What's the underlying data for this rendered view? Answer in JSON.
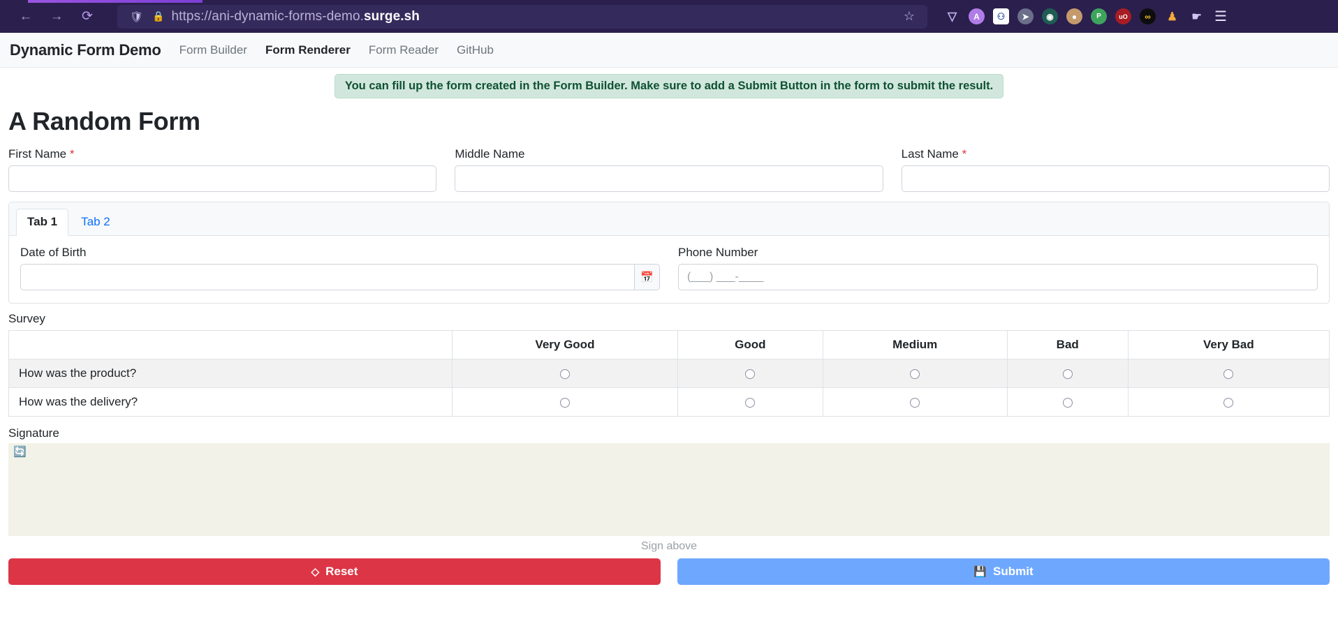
{
  "browser": {
    "url_prefix": "https://ani-dynamic-forms-demo.",
    "url_domain": "surge.sh",
    "back_icon": "back-arrow-icon",
    "forward_icon": "forward-arrow-icon",
    "reload_icon": "reload-icon",
    "shield_icon": "shield-icon",
    "lock_icon": "padlock-icon",
    "bookmark_icon": "star-icon",
    "menu_icon": "hamburger-menu-icon",
    "extensions": [
      {
        "name": "pocket-icon",
        "glyph": "▽"
      },
      {
        "name": "avatar-a-icon",
        "glyph": "A"
      },
      {
        "name": "bitwarden-icon",
        "glyph": "⬛"
      },
      {
        "name": "cursor-icon",
        "glyph": "➤"
      },
      {
        "name": "goggles-icon",
        "glyph": "◉"
      },
      {
        "name": "cookie-icon",
        "glyph": "●"
      },
      {
        "name": "pdf-icon",
        "glyph": "Pdf"
      },
      {
        "name": "ublock-icon",
        "glyph": "uO"
      },
      {
        "name": "infinity-icon",
        "glyph": "∞"
      },
      {
        "name": "person-check-icon",
        "glyph": "♟"
      },
      {
        "name": "thumbs-up-icon",
        "glyph": "☝"
      }
    ]
  },
  "navbar": {
    "brand": "Dynamic Form Demo",
    "links": [
      {
        "label": "Form Builder",
        "active": false
      },
      {
        "label": "Form Renderer",
        "active": true
      },
      {
        "label": "Form Reader",
        "active": false
      },
      {
        "label": "GitHub",
        "active": false
      }
    ]
  },
  "alert": {
    "text": "You can fill up the form created in the Form Builder. Make sure to add a Submit Button in the form to submit the result.",
    "bg_color": "#d1e7dd",
    "text_color": "#0f5132"
  },
  "form": {
    "title": "A Random Form",
    "name_fields": [
      {
        "label": "First Name",
        "required": true,
        "value": "",
        "placeholder": ""
      },
      {
        "label": "Middle Name",
        "required": false,
        "value": "",
        "placeholder": ""
      },
      {
        "label": "Last Name",
        "required": true,
        "value": "",
        "placeholder": ""
      }
    ],
    "tabs": [
      {
        "label": "Tab 1",
        "active": true
      },
      {
        "label": "Tab 2",
        "active": false
      }
    ],
    "date_of_birth": {
      "label": "Date of Birth",
      "value": "",
      "placeholder": "",
      "button_icon": "calendar-icon"
    },
    "phone_number": {
      "label": "Phone Number",
      "value": "",
      "placeholder": "(___) ___-____"
    },
    "survey": {
      "label": "Survey",
      "columns": [
        "",
        "Very Good",
        "Good",
        "Medium",
        "Bad",
        "Very Bad"
      ],
      "rows": [
        {
          "question": "How was the product?",
          "selected": null
        },
        {
          "question": "How was the delivery?",
          "selected": null
        }
      ]
    },
    "signature": {
      "label": "Signature",
      "refresh_icon": "refresh-icon",
      "hint": "Sign above",
      "pad_color": "#f2f2e8"
    },
    "buttons": [
      {
        "label": "Reset",
        "icon": "eraser-icon",
        "color": "#dc3545"
      },
      {
        "label": "Submit",
        "icon": "save-icon",
        "color": "#6ea8fe"
      }
    ]
  }
}
